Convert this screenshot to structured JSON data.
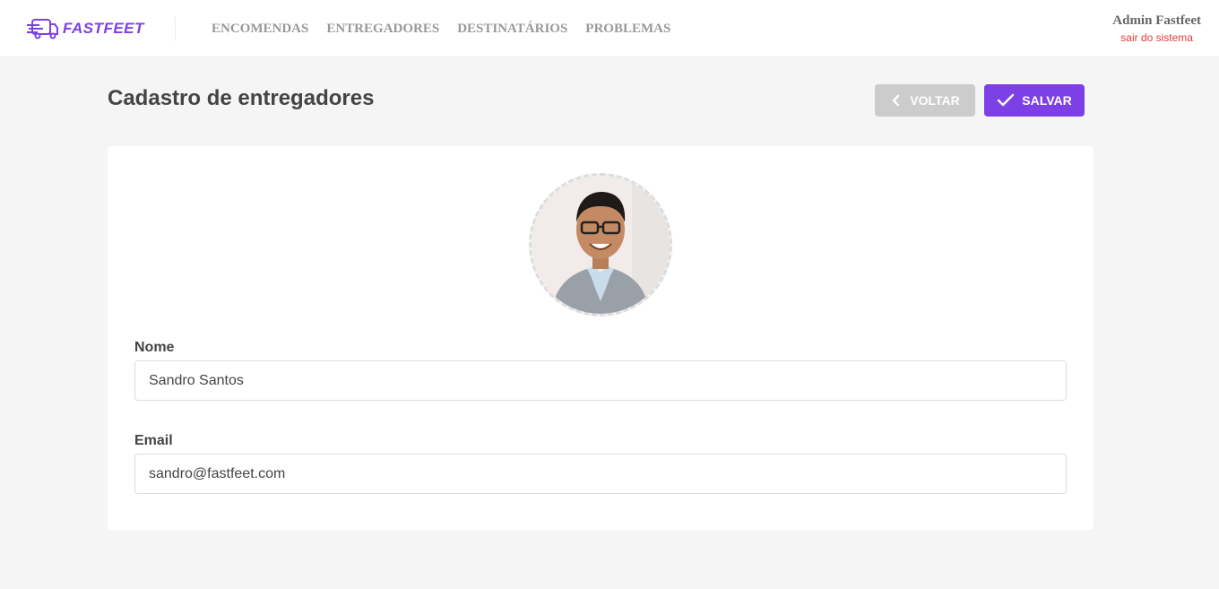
{
  "header": {
    "logo_text": "FASTFEET",
    "nav": [
      "ENCOMENDAS",
      "ENTREGADORES",
      "DESTINATÁRIOS",
      "PROBLEMAS"
    ],
    "user_name": "Admin Fastfeet",
    "logout_label": "sair do sistema"
  },
  "page": {
    "title": "Cadastro de entregadores",
    "back_label": "VOLTAR",
    "save_label": "SALVAR"
  },
  "form": {
    "name_label": "Nome",
    "name_value": "Sandro Santos",
    "email_label": "Email",
    "email_value": "sandro@fastfeet.com"
  },
  "colors": {
    "brand": "#7d40e7",
    "back_button": "#cccccc",
    "logout": "#de3b3b",
    "background": "#f5f5f5"
  },
  "icons": {
    "logo": "truck-speed-icon",
    "back": "chevron-left-icon",
    "save": "check-icon"
  }
}
